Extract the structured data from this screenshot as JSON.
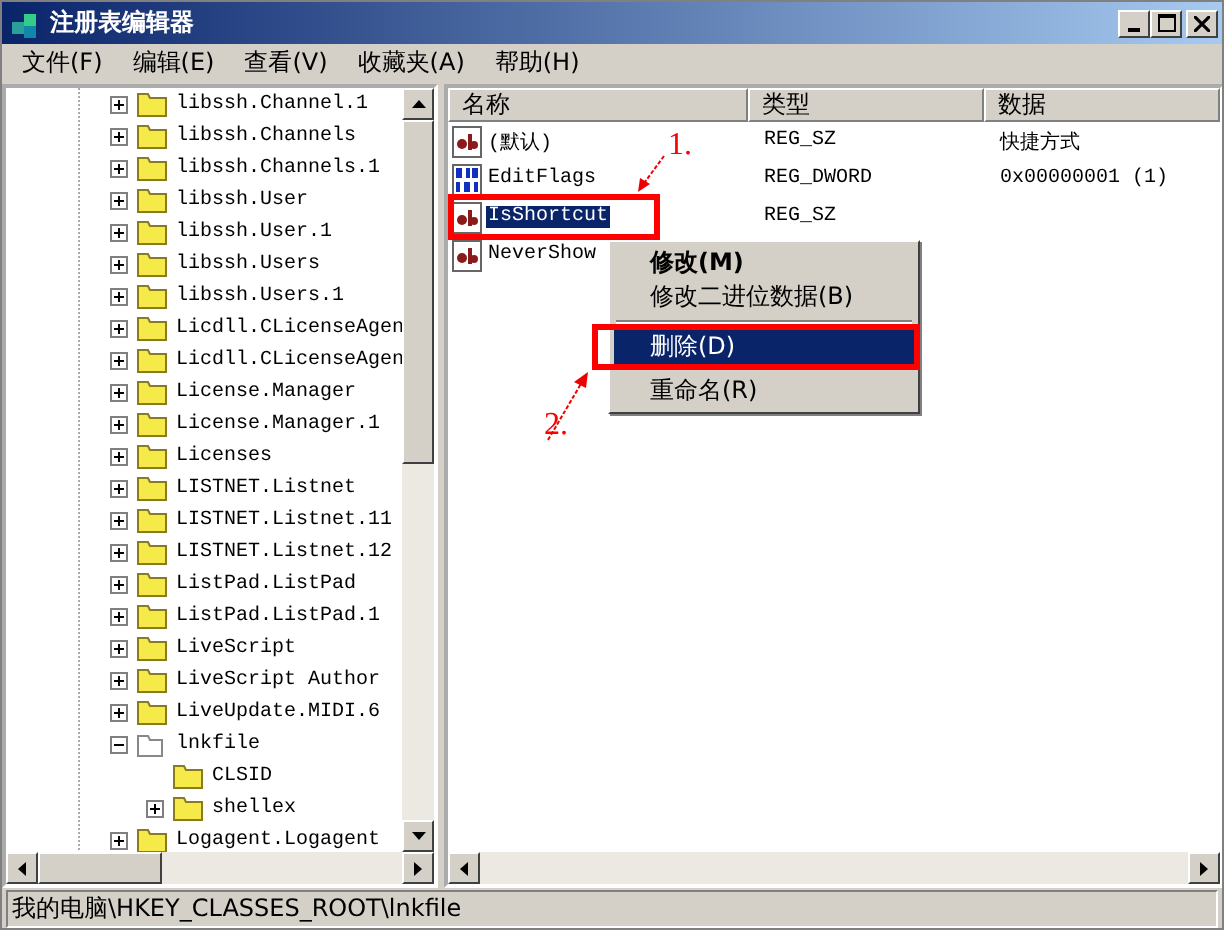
{
  "window": {
    "title": "注册表编辑器"
  },
  "menu": [
    {
      "label": "文件(F)"
    },
    {
      "label": "编辑(E)"
    },
    {
      "label": "查看(V)"
    },
    {
      "label": "收藏夹(A)"
    },
    {
      "label": "帮助(H)"
    }
  ],
  "tree": {
    "items": [
      {
        "label": "libssh.Channel.1",
        "has_children": true,
        "expanded": false
      },
      {
        "label": "libssh.Channels",
        "has_children": true,
        "expanded": false
      },
      {
        "label": "libssh.Channels.1",
        "has_children": true,
        "expanded": false
      },
      {
        "label": "libssh.User",
        "has_children": true,
        "expanded": false
      },
      {
        "label": "libssh.User.1",
        "has_children": true,
        "expanded": false
      },
      {
        "label": "libssh.Users",
        "has_children": true,
        "expanded": false
      },
      {
        "label": "libssh.Users.1",
        "has_children": true,
        "expanded": false
      },
      {
        "label": "Licdll.CLicenseAgen",
        "has_children": true,
        "expanded": false
      },
      {
        "label": "Licdll.CLicenseAgen",
        "has_children": true,
        "expanded": false
      },
      {
        "label": "License.Manager",
        "has_children": true,
        "expanded": false
      },
      {
        "label": "License.Manager.1",
        "has_children": true,
        "expanded": false
      },
      {
        "label": "Licenses",
        "has_children": true,
        "expanded": false
      },
      {
        "label": "LISTNET.Listnet",
        "has_children": true,
        "expanded": false
      },
      {
        "label": "LISTNET.Listnet.11",
        "has_children": true,
        "expanded": false
      },
      {
        "label": "LISTNET.Listnet.12",
        "has_children": true,
        "expanded": false
      },
      {
        "label": "ListPad.ListPad",
        "has_children": true,
        "expanded": false
      },
      {
        "label": "ListPad.ListPad.1",
        "has_children": true,
        "expanded": false
      },
      {
        "label": "LiveScript",
        "has_children": true,
        "expanded": false
      },
      {
        "label": "LiveScript Author",
        "has_children": true,
        "expanded": false
      },
      {
        "label": "LiveUpdate.MIDI.6",
        "has_children": true,
        "expanded": false
      },
      {
        "label": "lnkfile",
        "has_children": true,
        "expanded": true,
        "children": [
          {
            "label": "CLSID",
            "has_children": false,
            "expanded": false
          },
          {
            "label": "shellex",
            "has_children": true,
            "expanded": false
          }
        ]
      },
      {
        "label": "Logagent.Logagent",
        "has_children": true,
        "expanded": false
      }
    ]
  },
  "values": {
    "columns": [
      "名称",
      "类型",
      "数据"
    ],
    "rows": [
      {
        "name": "(默认)",
        "type": "REG_SZ",
        "data": "快捷方式",
        "kind": "string",
        "selected": false
      },
      {
        "name": "EditFlags",
        "type": "REG_DWORD",
        "data": "0x00000001 (1)",
        "kind": "binary",
        "selected": false
      },
      {
        "name": "IsShortcut",
        "type": "REG_SZ",
        "data": "",
        "kind": "string",
        "selected": true
      },
      {
        "name": "NeverShow",
        "kind": "string",
        "selected": false
      }
    ]
  },
  "context_menu": [
    {
      "kind": "item",
      "label": "修改(M)",
      "bold": true,
      "selected": false
    },
    {
      "kind": "item",
      "label": "修改二进位数据(B)",
      "bold": false,
      "selected": false
    },
    {
      "kind": "separator"
    },
    {
      "kind": "item",
      "label": "删除(D)",
      "bold": false,
      "selected": true
    },
    {
      "kind": "item",
      "label": "重命名(R)",
      "bold": false,
      "selected": false
    }
  ],
  "annotations": [
    {
      "label": "1."
    },
    {
      "label": "2."
    }
  ],
  "status_bar": "我的电脑\\HKEY_CLASSES_ROOT\\lnkfile"
}
